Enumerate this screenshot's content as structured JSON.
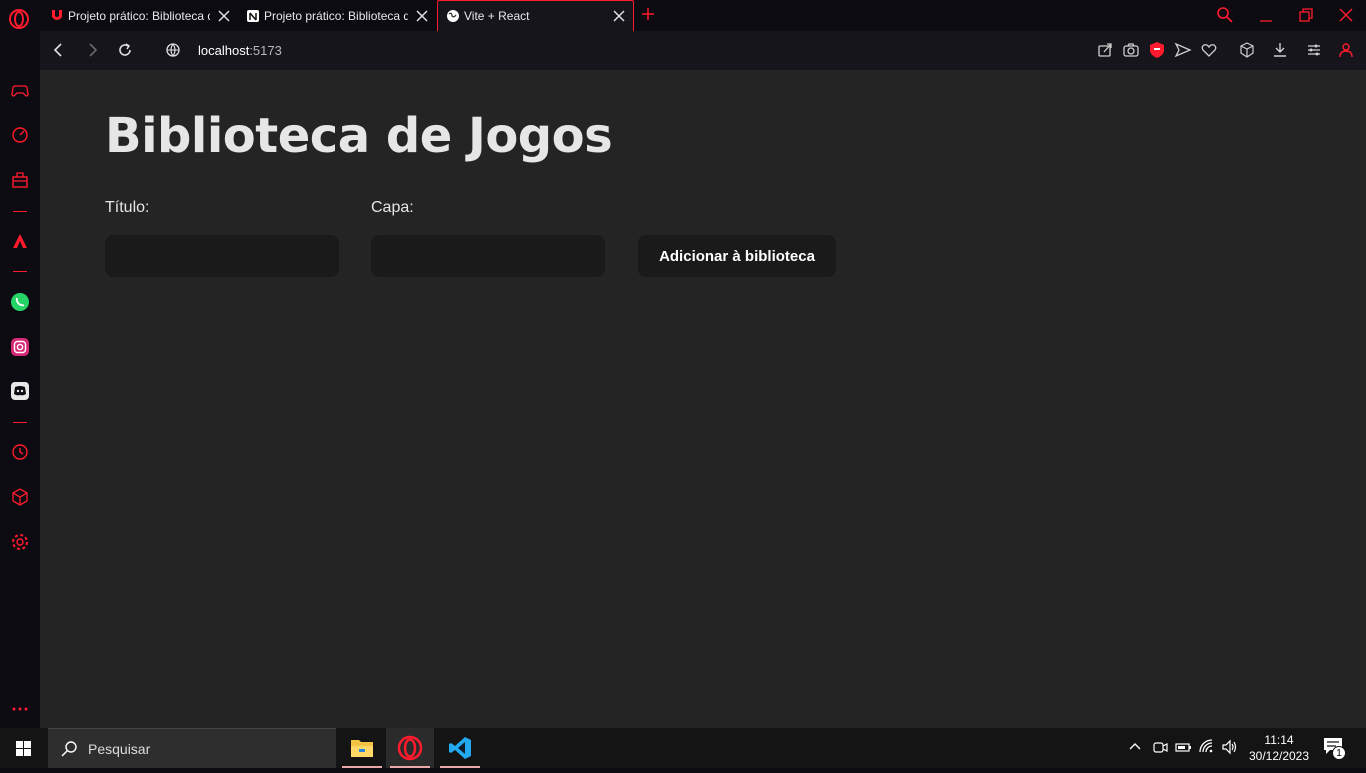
{
  "browser": {
    "tabs": [
      {
        "label": "Projeto prático: Biblioteca d",
        "favicon": "bullet-icon"
      },
      {
        "label": "Projeto prático: Biblioteca d",
        "favicon": "notion-icon"
      },
      {
        "label": "Vite + React",
        "favicon": "globe-icon",
        "active": true
      }
    ],
    "address": {
      "host": "localhost",
      "port": ":5173"
    },
    "accent_color": "#ff1b2d"
  },
  "page": {
    "title": "Biblioteca de Jogos",
    "form": {
      "title_label": "Título:",
      "title_value": "",
      "cover_label": "Capa:",
      "cover_value": "",
      "submit_label": "Adicionar à biblioteca"
    }
  },
  "taskbar": {
    "search_placeholder": "Pesquisar",
    "apps": [
      "file-explorer-icon",
      "opera-icon",
      "vscode-icon"
    ],
    "clock": {
      "time": "11:14",
      "date": "30/12/2023"
    },
    "notifications": "1"
  }
}
